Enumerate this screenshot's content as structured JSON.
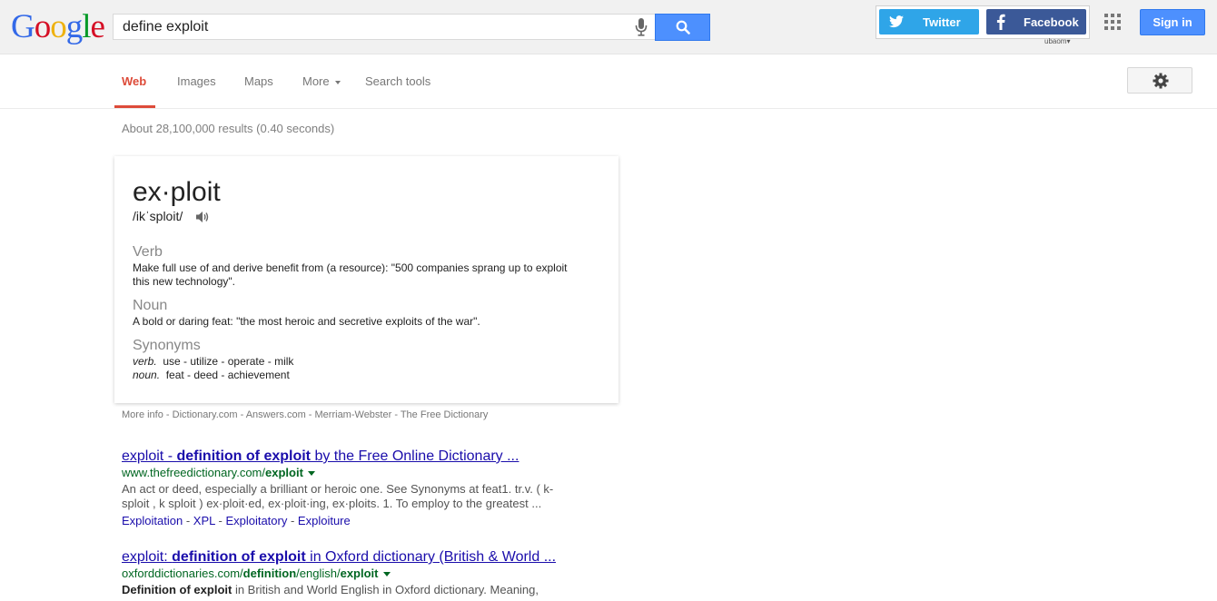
{
  "header": {
    "logo_letters": [
      {
        "ch": "G",
        "color": "#3369e8"
      },
      {
        "ch": "o",
        "color": "#d50f25"
      },
      {
        "ch": "o",
        "color": "#eeb211"
      },
      {
        "ch": "g",
        "color": "#3369e8"
      },
      {
        "ch": "l",
        "color": "#009925"
      },
      {
        "ch": "e",
        "color": "#d50f25"
      }
    ],
    "search_value": "define exploit",
    "twitter_label": "Twitter",
    "facebook_label": "Facebook",
    "social_sub": "ubaom▾",
    "signin_label": "Sign in"
  },
  "nav": {
    "web": "Web",
    "images": "Images",
    "maps": "Maps",
    "more": "More",
    "tools": "Search tools"
  },
  "stats": "About 28,100,000 results (0.40 seconds)",
  "definition": {
    "word": "ex·ploit",
    "phonetic": "/ikˈsploit/",
    "verb_pos": "Verb",
    "verb_def": "Make full use of and derive benefit from (a resource): \"500 companies sprang up to exploit this new technology\".",
    "noun_pos": "Noun",
    "noun_def": "A bold or daring feat: \"the most heroic and secretive exploits of the war\".",
    "syn_heading": "Synonyms",
    "syn_verb_label": "verb.",
    "syn_verb": "use - utilize - operate - milk",
    "syn_noun_label": "noun.",
    "syn_noun": "feat - deed - achievement"
  },
  "more_info": "More info - Dictionary.com - Answers.com - Merriam-Webster - The Free Dictionary",
  "results": [
    {
      "title_pre": "exploit - ",
      "title_bold": "definition of exploit",
      "title_post": " by the Free Online Dictionary ...",
      "url_pre": "www.thefreedictionary.com/",
      "url_bold": "exploit",
      "url_post": "",
      "snippet": "An act or deed, especially a brilliant or heroic one. See Synonyms at feat1. tr.v. ( k-sploit , k sploit ) ex·ploit·ed, ex·ploit·ing, ex·ploits. 1. To employ to the greatest ...",
      "sitelinks": [
        "Exploitation",
        "XPL",
        "Exploitatory",
        "Exploiture"
      ]
    },
    {
      "title_pre": "exploit: ",
      "title_bold": "definition of exploit",
      "title_post": " in Oxford dictionary (British & World ...",
      "url_pre": "oxforddictionaries.com/",
      "url_bold": "definition",
      "url_mid": "/english/",
      "url_bold2": "exploit",
      "snippet_bold": "Definition of exploit",
      "snippet": " in British and World English in Oxford dictionary. Meaning,"
    }
  ]
}
